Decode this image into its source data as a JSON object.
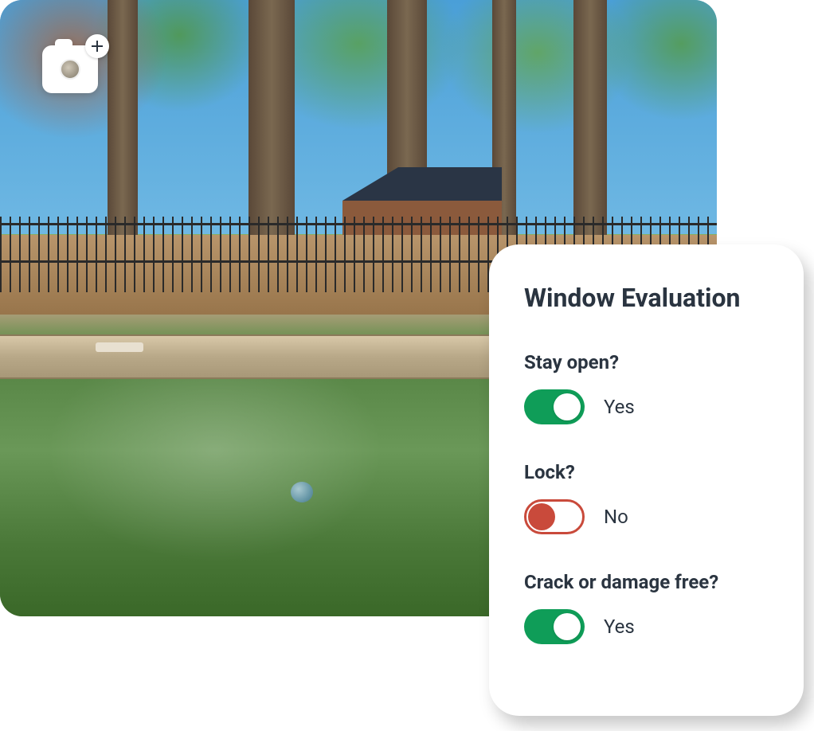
{
  "card": {
    "title": "Window Evaluation",
    "questions": [
      {
        "label": "Stay open?",
        "value_label": "Yes",
        "on": true
      },
      {
        "label": "Lock?",
        "value_label": "No",
        "on": false
      },
      {
        "label": "Crack or damage free?",
        "value_label": "Yes",
        "on": true
      }
    ]
  },
  "icons": {
    "camera": "camera-icon",
    "plus": "plus-icon"
  },
  "colors": {
    "toggle_on": "#0f9d58",
    "toggle_off": "#c94a3b",
    "text_primary": "#2a3440"
  }
}
